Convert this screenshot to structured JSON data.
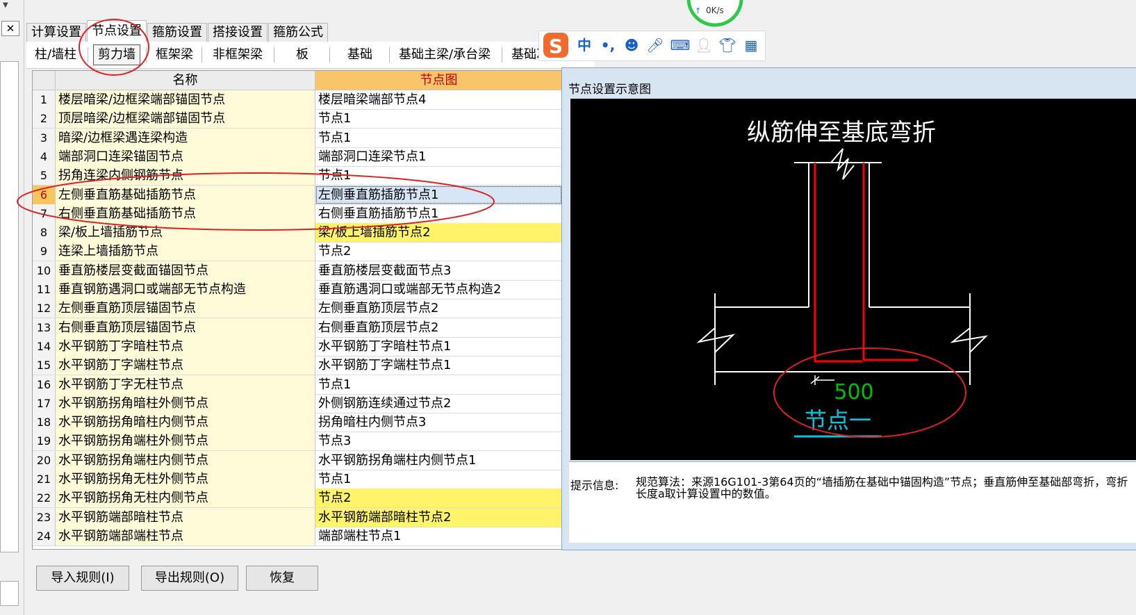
{
  "top_tabs": [
    "计算设置",
    "节点设置",
    "箍筋设置",
    "搭接设置",
    "箍筋公式"
  ],
  "sub_tabs": [
    "柱/墙柱",
    "剪力墙",
    "框架梁",
    "非框架梁",
    "板",
    "基础",
    "基础主梁/承台梁",
    "基础次"
  ],
  "grid": {
    "col_name": "名称",
    "col_node": "节点图",
    "rows": [
      {
        "n": "1",
        "name": "楼层暗梁/边框梁端部锚固节点",
        "node": "楼层暗梁端部节点4"
      },
      {
        "n": "2",
        "name": "顶层暗梁/边框梁端部锚固节点",
        "node": "节点1"
      },
      {
        "n": "3",
        "name": "暗梁/边框梁遇连梁构造",
        "node": "节点1"
      },
      {
        "n": "4",
        "name": "端部洞口连梁锚固节点",
        "node": "端部洞口连梁节点1"
      },
      {
        "n": "5",
        "name": "拐角连梁内侧钢筋节点",
        "node": "节点1"
      },
      {
        "n": "6",
        "name": "左侧垂直筋基础插筋节点",
        "node": "左侧垂直筋插筋节点1"
      },
      {
        "n": "7",
        "name": "右侧垂直筋基础插筋节点",
        "node": "右侧垂直筋插筋节点1"
      },
      {
        "n": "8",
        "name": "梁/板上墙插筋节点",
        "node": "梁/板上墙插筋节点2"
      },
      {
        "n": "9",
        "name": "连梁上墙插筋节点",
        "node": "节点2"
      },
      {
        "n": "10",
        "name": "垂直筋楼层变截面锚固节点",
        "node": "垂直筋楼层变截面节点3"
      },
      {
        "n": "11",
        "name": "垂直钢筋遇洞口或端部无节点构造",
        "node": "垂直筋遇洞口或端部无节点构造2"
      },
      {
        "n": "12",
        "name": "左侧垂直筋顶层锚固节点",
        "node": "左侧垂直筋顶层节点2"
      },
      {
        "n": "13",
        "name": "右侧垂直筋顶层锚固节点",
        "node": "右侧垂直筋顶层节点2"
      },
      {
        "n": "14",
        "name": "水平钢筋丁字暗柱节点",
        "node": "水平钢筋丁字暗柱节点1"
      },
      {
        "n": "15",
        "name": "水平钢筋丁字端柱节点",
        "node": "水平钢筋丁字端柱节点1"
      },
      {
        "n": "16",
        "name": "水平钢筋丁字无柱节点",
        "node": "节点1"
      },
      {
        "n": "17",
        "name": "水平钢筋拐角暗柱外侧节点",
        "node": "外侧钢筋连续通过节点2"
      },
      {
        "n": "18",
        "name": "水平钢筋拐角暗柱内侧节点",
        "node": "拐角暗柱内侧节点3"
      },
      {
        "n": "19",
        "name": "水平钢筋拐角端柱外侧节点",
        "node": "节点3"
      },
      {
        "n": "20",
        "name": "水平钢筋拐角端柱内侧节点",
        "node": "水平钢筋拐角端柱内侧节点1"
      },
      {
        "n": "21",
        "name": "水平钢筋拐角无柱外侧节点",
        "node": "节点1"
      },
      {
        "n": "22",
        "name": "水平钢筋拐角无柱内侧节点",
        "node": "节点2"
      },
      {
        "n": "23",
        "name": "水平钢筋端部暗柱节点",
        "node": "水平钢筋端部暗柱节点2"
      },
      {
        "n": "24",
        "name": "水平钢筋端部端柱节点",
        "node": "端部端柱节点1"
      }
    ]
  },
  "preview": {
    "title": "节点设置示意图",
    "diagram_title": "纵筋伸至基底弯折",
    "dimension": "500",
    "node_label": "节点一",
    "hint_label": "提示信息:",
    "hint_text": "规范算法：来源16G101-3第64页的“墙插筋在基础中锚固构造”节点；垂直筋伸至基础部弯折，弯折长度a取计算设置中的数值。"
  },
  "buttons": {
    "import": "导入规则(I)",
    "export": "导出规则(O)",
    "restore": "恢复"
  },
  "ime": {
    "lang": "中",
    "punct": "•,"
  },
  "speed": "0K/s",
  "colors": {
    "name_col_bg": "#fffbd9",
    "highlight_yellow": "#fff36a",
    "header_node": "#f9c56a",
    "annotation_red": "#e02020",
    "rebar_red": "#ff0000",
    "dim_green": "#00c000",
    "label_cyan": "#00c8e0"
  }
}
